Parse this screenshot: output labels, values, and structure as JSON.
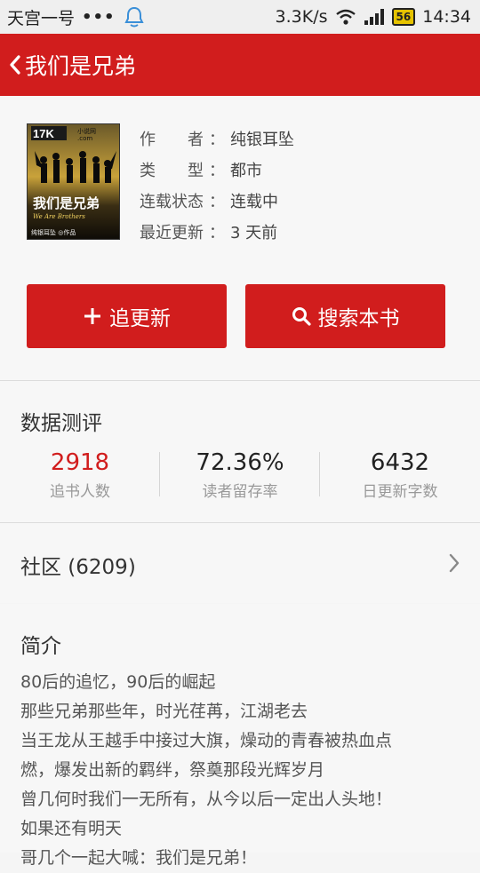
{
  "status_bar": {
    "carrier": "天宫一号",
    "dots": "•••",
    "speed": "3.3K/s",
    "battery": "56",
    "time": "14:34"
  },
  "app_bar": {
    "title": "我们是兄弟"
  },
  "book": {
    "cover_text": {
      "logo": "17K",
      "logo_sub": "小说网",
      "logo_dom": ".com",
      "title": "我们是兄弟",
      "subtitle": "We Are Brothers",
      "author_tag": "纯银耳坠 ◎作品"
    },
    "fields": [
      {
        "key": "作　　者",
        "value": "纯银耳坠"
      },
      {
        "key": "类　　型",
        "value": "都市"
      },
      {
        "key": "连载状态",
        "value": "连载中"
      },
      {
        "key": "最近更新",
        "value": "3 天前"
      }
    ],
    "colon": "：",
    "follow_label": "追更新",
    "search_label": "搜索本书"
  },
  "stats": {
    "title": "数据测评",
    "items": [
      {
        "value": "2918",
        "label": "追书人数"
      },
      {
        "value": "72.36%",
        "label": "读者留存率"
      },
      {
        "value": "6432",
        "label": "日更新字数"
      }
    ]
  },
  "community": {
    "label": "社区 (6209)"
  },
  "intro": {
    "title": "简介",
    "lines": [
      "80后的追忆，90后的崛起",
      "那些兄弟那些年，时光荏苒，江湖老去",
      "当王龙从王越手中接过大旗，燥动的青春被热血点",
      "燃，爆发出新的羁绊，祭奠那段光辉岁月",
      "曾几何时我们一无所有，从今以后一定出人头地！",
      "如果还有明天",
      "哥几个一起大喊：我们是兄弟！"
    ]
  },
  "colors": {
    "accent": "#d11d1d",
    "highlight_value": "#d11d1d"
  }
}
